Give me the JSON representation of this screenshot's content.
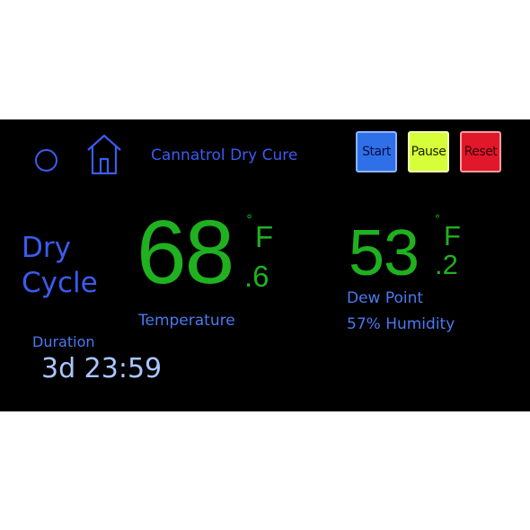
{
  "header": {
    "app_title": "Cannatrol Dry Cure",
    "start_label": "Start",
    "pause_label": "Pause",
    "reset_label": "Reset",
    "status_icon": "circle-icon",
    "home_icon": "home-icon"
  },
  "cycle": {
    "line1": "Dry",
    "line2": "Cycle"
  },
  "temperature": {
    "integer": "68",
    "decimal": ".6",
    "degree": "°",
    "unit": "F",
    "label": "Temperature"
  },
  "dew_point": {
    "integer": "53",
    "decimal": ".2",
    "degree": "°",
    "unit": "F",
    "label": "Dew Point",
    "humidity": "57% Humidity"
  },
  "duration": {
    "label": "Duration",
    "value": "3d  23:59"
  },
  "colors": {
    "screen_bg": "#000000",
    "title_blue": "#3a5cf0",
    "label_blue": "#4a7af0",
    "reading_green": "#1fb11f",
    "start_button": "#2f6fe8",
    "pause_button": "#d6ff3a",
    "reset_button": "#e0182a"
  }
}
